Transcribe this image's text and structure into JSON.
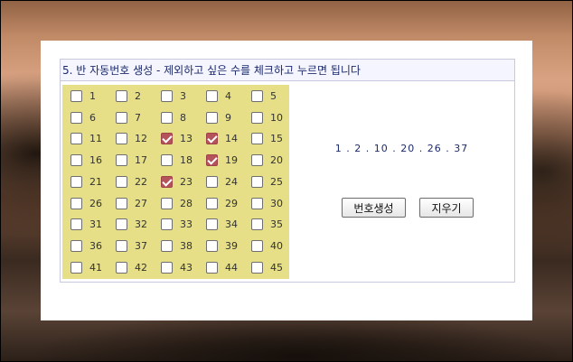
{
  "panel": {
    "title": "5. 반 자동번호 생성 - 제외하고 싶은 수를 체크하고 누르면 됩니다"
  },
  "numbers": [
    {
      "label": "1",
      "checked": false
    },
    {
      "label": "2",
      "checked": false
    },
    {
      "label": "3",
      "checked": false
    },
    {
      "label": "4",
      "checked": false
    },
    {
      "label": "5",
      "checked": false
    },
    {
      "label": "6",
      "checked": false
    },
    {
      "label": "7",
      "checked": false
    },
    {
      "label": "8",
      "checked": false
    },
    {
      "label": "9",
      "checked": false
    },
    {
      "label": "10",
      "checked": false
    },
    {
      "label": "11",
      "checked": false
    },
    {
      "label": "12",
      "checked": false
    },
    {
      "label": "13",
      "checked": true
    },
    {
      "label": "14",
      "checked": true
    },
    {
      "label": "15",
      "checked": false
    },
    {
      "label": "16",
      "checked": false
    },
    {
      "label": "17",
      "checked": false
    },
    {
      "label": "18",
      "checked": false
    },
    {
      "label": "19",
      "checked": true
    },
    {
      "label": "20",
      "checked": false
    },
    {
      "label": "21",
      "checked": false
    },
    {
      "label": "22",
      "checked": false
    },
    {
      "label": "23",
      "checked": true
    },
    {
      "label": "24",
      "checked": false
    },
    {
      "label": "25",
      "checked": false
    },
    {
      "label": "26",
      "checked": false
    },
    {
      "label": "27",
      "checked": false
    },
    {
      "label": "28",
      "checked": false
    },
    {
      "label": "29",
      "checked": false
    },
    {
      "label": "30",
      "checked": false
    },
    {
      "label": "31",
      "checked": false
    },
    {
      "label": "32",
      "checked": false
    },
    {
      "label": "33",
      "checked": false
    },
    {
      "label": "34",
      "checked": false
    },
    {
      "label": "35",
      "checked": false
    },
    {
      "label": "36",
      "checked": false
    },
    {
      "label": "37",
      "checked": false
    },
    {
      "label": "38",
      "checked": false
    },
    {
      "label": "39",
      "checked": false
    },
    {
      "label": "40",
      "checked": false
    },
    {
      "label": "41",
      "checked": false
    },
    {
      "label": "42",
      "checked": false
    },
    {
      "label": "43",
      "checked": false
    },
    {
      "label": "44",
      "checked": false
    },
    {
      "label": "45",
      "checked": false
    }
  ],
  "result": {
    "text": "1 . 2 . 10 . 20 . 26 . 37"
  },
  "buttons": {
    "generate_label": "번호생성",
    "clear_label": "지우기"
  },
  "colors": {
    "grid_bg": "#e6df88",
    "checked_box": "#b5525a",
    "title_text": "#1c2a6a"
  }
}
